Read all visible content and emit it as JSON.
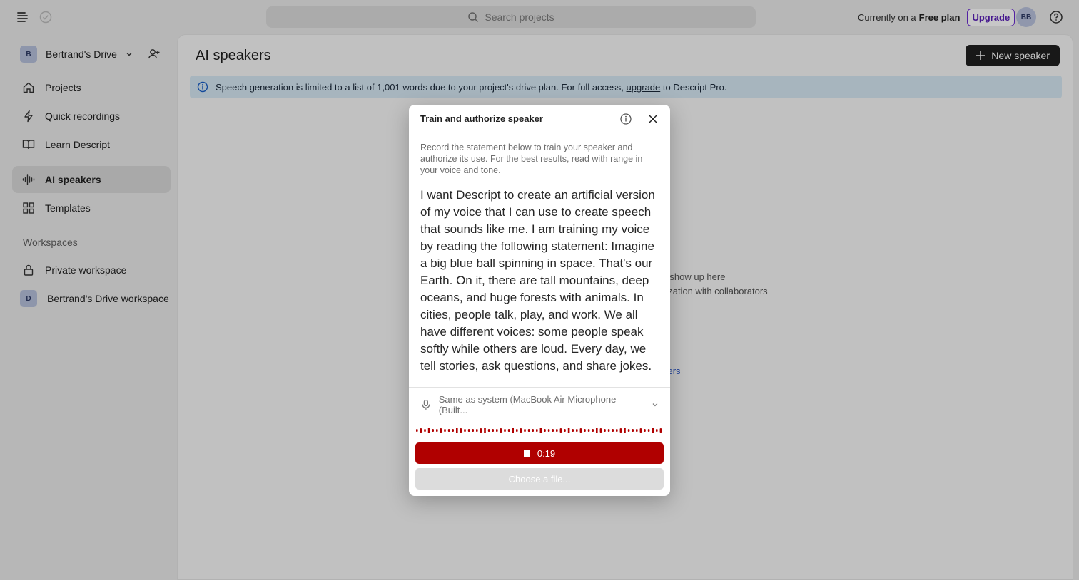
{
  "topbar": {
    "search_placeholder": "Search projects",
    "plan_prefix": "Currently on a",
    "plan_name": "Free plan",
    "upgrade_label": "Upgrade",
    "avatar_initials": "BB"
  },
  "sidebar": {
    "drive_initial": "B",
    "drive_name": "Bertrand's Drive",
    "items": [
      {
        "label": "Projects",
        "icon": "home-icon"
      },
      {
        "label": "Quick recordings",
        "icon": "lightning-icon"
      },
      {
        "label": "Learn Descript",
        "icon": "book-icon"
      },
      {
        "label": "AI speakers",
        "icon": "waveform-icon",
        "active": true
      },
      {
        "label": "Templates",
        "icon": "grid-icon"
      }
    ],
    "workspaces_label": "Workspaces",
    "workspaces": [
      {
        "label": "Private workspace",
        "icon": "lock-icon"
      },
      {
        "label": "Bertrand's Drive workspace",
        "initial": "D"
      }
    ]
  },
  "main": {
    "title": "AI speakers",
    "new_speaker_label": "New speaker",
    "banner_before": "Speech generation is limited to a list of 1,001 words due to your project's drive plan. For full access,",
    "banner_link": "upgrade",
    "banner_after": "to Descript Pro.",
    "empty_line1": "ll show up here",
    "empty_line2": "rization with collaborators",
    "empty_link": "kers"
  },
  "dialog": {
    "title": "Train and authorize speaker",
    "description": "Record the statement below to train your speaker and authorize its use. For the best results, read with range in your voice and tone.",
    "statement": "I want Descript to create an artificial version of my voice that I can use to create speech that sounds like me. I am training my voice by reading the following statement: Imagine a big blue ball spinning in space. That's our Earth. On it, there are tall mountains, deep oceans, and huge forests with animals. In cities, people talk, play, and work. We all have different voices: some people speak softly while others are loud. Every day, we tell stories, ask questions, and share jokes.",
    "mic_source": "Same as system (MacBook Air Microphone (Built...",
    "timer": "0:19",
    "choose_file_label": "Choose a file..."
  },
  "colors": {
    "record_red": "#b00000",
    "upgrade_purple": "#5a1fb8",
    "banner_blue": "#d7e8f4"
  }
}
